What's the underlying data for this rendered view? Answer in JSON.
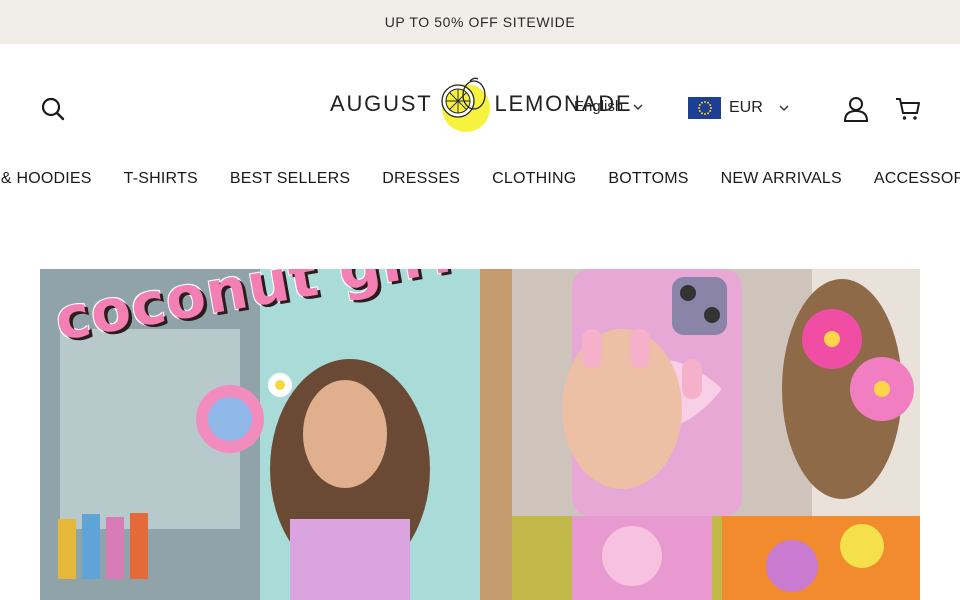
{
  "announcement": {
    "text": "UP TO 50% OFF SITEWIDE"
  },
  "header": {
    "logo": {
      "word_left": "AUGUST",
      "word_right": "LEMONADE"
    },
    "language": {
      "selected": "English"
    },
    "currency": {
      "selected": "EUR",
      "flag_icon": "eu-flag-icon"
    },
    "icons": {
      "search": "search-icon",
      "account": "user-icon",
      "cart": "cart-icon",
      "caret": "chevron-down-icon"
    }
  },
  "nav": {
    "items": [
      {
        "label": "SWEATSHIRTS & HOODIES"
      },
      {
        "label": "T-SHIRTS"
      },
      {
        "label": "BEST SELLERS"
      },
      {
        "label": "DRESSES"
      },
      {
        "label": "CLOTHING"
      },
      {
        "label": "BOTTOMS"
      },
      {
        "label": "NEW ARRIVALS"
      },
      {
        "label": "ACCESSORIES"
      }
    ]
  },
  "hero": {
    "title": "coconut girl"
  },
  "colors": {
    "announcement_bg": "#f1eee9",
    "brand_yellow": "#f4e64a",
    "accent_pink": "#f47fb2",
    "flag_blue": "#1c3f94"
  }
}
